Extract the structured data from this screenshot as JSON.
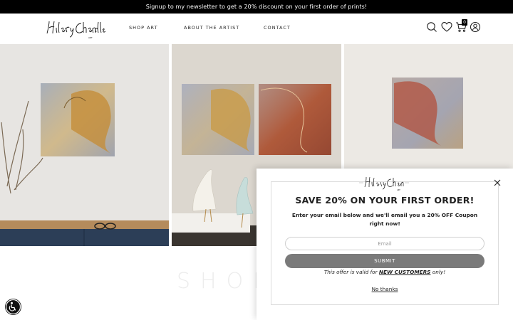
{
  "announcement": {
    "text": "Signup to my newsletter to get a 20% discount on your first order of prints!"
  },
  "header": {
    "logo_alt": "Hilary Chandler Art",
    "nav": [
      {
        "label": "SHOP ART"
      },
      {
        "label": "ABOUT THE ARTIST"
      },
      {
        "label": "CONTACT"
      }
    ],
    "cart_count": "0",
    "icons": [
      "search-icon",
      "heart-icon",
      "cart-icon",
      "account-icon"
    ]
  },
  "gallery": {
    "images": [
      "painting-on-wall-with-dried-branches",
      "two-paintings-with-bird-sculptures",
      "single-red-painting-on-wall"
    ]
  },
  "section": {
    "heading": "SHOP"
  },
  "popup": {
    "title": "SAVE 20% ON YOUR FIRST ORDER!",
    "text": "Enter your email below and we'll email you a 20% OFF Coupon right now!",
    "email_placeholder": "Email",
    "submit_label": "SUBMIT",
    "offer_prefix": "This offer is valid for ",
    "offer_highlight": "NEW CUSTOMERS",
    "offer_suffix": " only!",
    "dismiss_label": "No thanks"
  },
  "colors": {
    "announcement_bg": "#000000",
    "submit_bg": "#7a7a7a",
    "accent": "#222222"
  }
}
